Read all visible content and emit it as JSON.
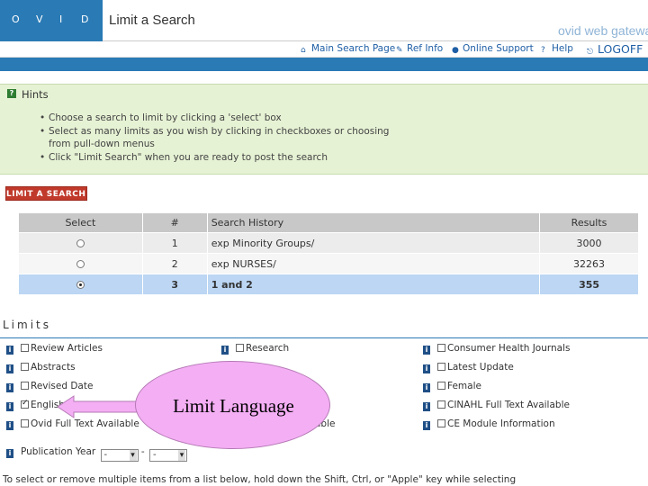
{
  "header": {
    "logo_letters": [
      "O",
      "V",
      "I",
      "D"
    ],
    "title": "Limit a Search",
    "brand_text": "ovid web gateway"
  },
  "nav": {
    "main_search": "Main Search Page",
    "ref_info": "Ref Info",
    "online_support": "Online Support",
    "help": "Help",
    "logoff": "LOGOFF"
  },
  "hints": {
    "title": "Hints",
    "items": [
      "Choose a search to limit by clicking a 'select' box",
      "Select as many limits as you wish by clicking in checkboxes or choosing from pull-down menus",
      "Click \"Limit Search\" when you are ready to post the search"
    ]
  },
  "limit_button": "LIMIT A SEARCH »",
  "history": {
    "headers": {
      "select": "Select",
      "num": "#",
      "history": "Search History",
      "results": "Results"
    },
    "rows": [
      {
        "num": "1",
        "history": "exp Minority Groups/",
        "results": "3000",
        "selected": false
      },
      {
        "num": "2",
        "history": "exp NURSES/",
        "results": "32263",
        "selected": false
      },
      {
        "num": "3",
        "history": "1 and 2",
        "results": "355",
        "selected": true
      }
    ]
  },
  "limits": {
    "heading": "Limits",
    "col1": [
      "Review Articles",
      "Abstracts",
      "Revised Date",
      "English",
      "Ovid Full Text Available"
    ],
    "col2": [
      "Research",
      "",
      "",
      "",
      ""
    ],
    "col2_tail": "able",
    "col3": [
      "Consumer Health Journals",
      "Latest Update",
      "Female",
      "CINAHL Full Text Available",
      "CE Module Information"
    ],
    "english_checked": true,
    "pub_year_label": "Publication Year",
    "pub_year_from": "-",
    "pub_year_to": "-",
    "shift_note": "To select or remove multiple items from a list below, hold down the Shift, Ctrl, or \"Apple\" key while selecting"
  },
  "callout": {
    "text": "Limit Language"
  },
  "colors": {
    "brand_blue": "#2a7ab5",
    "hint_bg": "#e6f2d4",
    "button_red": "#c0392b",
    "selected_row": "#bcd6f4",
    "callout_pink": "#f4aef4"
  }
}
